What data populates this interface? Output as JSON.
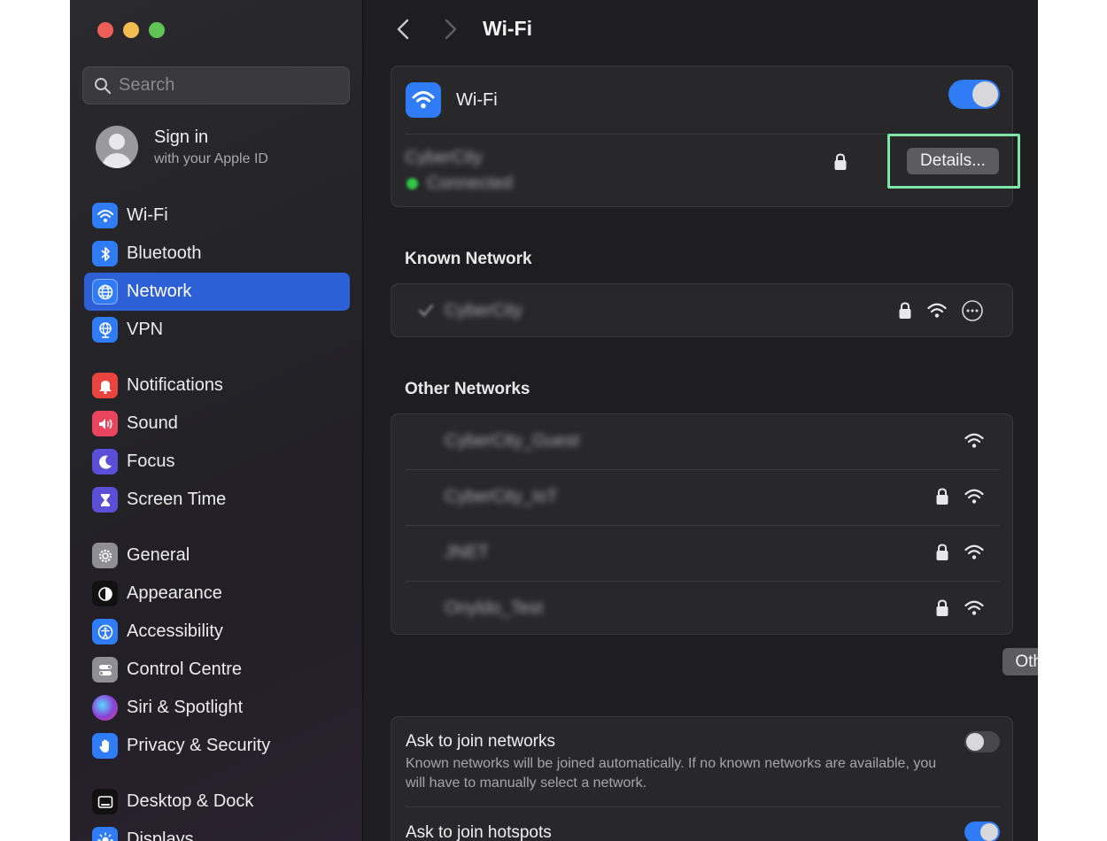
{
  "window": {
    "search": {
      "placeholder": "Search"
    },
    "account": {
      "title": "Sign in",
      "subtitle": "with your Apple ID"
    }
  },
  "sidebar": {
    "items": [
      {
        "label": "Wi-Fi",
        "icon": "wifi-icon",
        "color": "#2f7cf6"
      },
      {
        "label": "Bluetooth",
        "icon": "bluetooth-icon",
        "color": "#2f7cf6"
      },
      {
        "label": "Network",
        "icon": "globe-icon",
        "color": "#2f7cf6",
        "active": true
      },
      {
        "label": "VPN",
        "icon": "vpn-globe-icon",
        "color": "#2f7cf6"
      },
      {
        "label": "Notifications",
        "icon": "bell-icon",
        "color": "#e9453e"
      },
      {
        "label": "Sound",
        "icon": "speaker-icon",
        "color": "#e9455e"
      },
      {
        "label": "Focus",
        "icon": "moon-icon",
        "color": "#5a4fd6"
      },
      {
        "label": "Screen Time",
        "icon": "hourglass-icon",
        "color": "#5a4fd6"
      },
      {
        "label": "General",
        "icon": "gear-icon",
        "color": "#8e8e93"
      },
      {
        "label": "Appearance",
        "icon": "appearance-icon",
        "color": "#111111"
      },
      {
        "label": "Accessibility",
        "icon": "accessibility-icon",
        "color": "#2f7cf6"
      },
      {
        "label": "Control Centre",
        "icon": "toggles-icon",
        "color": "#8e8e93"
      },
      {
        "label": "Siri & Spotlight",
        "icon": "siri-icon",
        "color": "#8a3fd6"
      },
      {
        "label": "Privacy & Security",
        "icon": "hand-icon",
        "color": "#2f7cf6"
      },
      {
        "label": "Desktop & Dock",
        "icon": "dock-icon",
        "color": "#111111"
      },
      {
        "label": "Displays",
        "icon": "sun-icon",
        "color": "#2f7cf6"
      }
    ]
  },
  "main": {
    "title": "Wi-Fi",
    "wifi": {
      "label": "Wi-Fi",
      "enabled": true,
      "connected_network": "CyberCity",
      "connected_status": "Connected",
      "details_button": "Details..."
    },
    "known": {
      "heading": "Known Network",
      "network": "CyberCity"
    },
    "other": {
      "heading": "Other Networks",
      "networks": [
        {
          "name": "CyberCity_Guest",
          "locked": false
        },
        {
          "name": "CyberCity_IoT",
          "locked": true
        },
        {
          "name": "JNET",
          "locked": true
        },
        {
          "name": "Onyldo_Test",
          "locked": true
        }
      ],
      "other_button": "Other..."
    },
    "settings": {
      "ask_join_networks": {
        "title": "Ask to join networks",
        "description": "Known networks will be joined automatically. If no known networks are available, you will have to manually select a network.",
        "enabled": false
      },
      "ask_join_hotspots": {
        "title": "Ask to join hotspots",
        "enabled": true
      }
    }
  },
  "colors": {
    "accent": "#2f7cf6",
    "highlight": "#7ee6a8"
  }
}
